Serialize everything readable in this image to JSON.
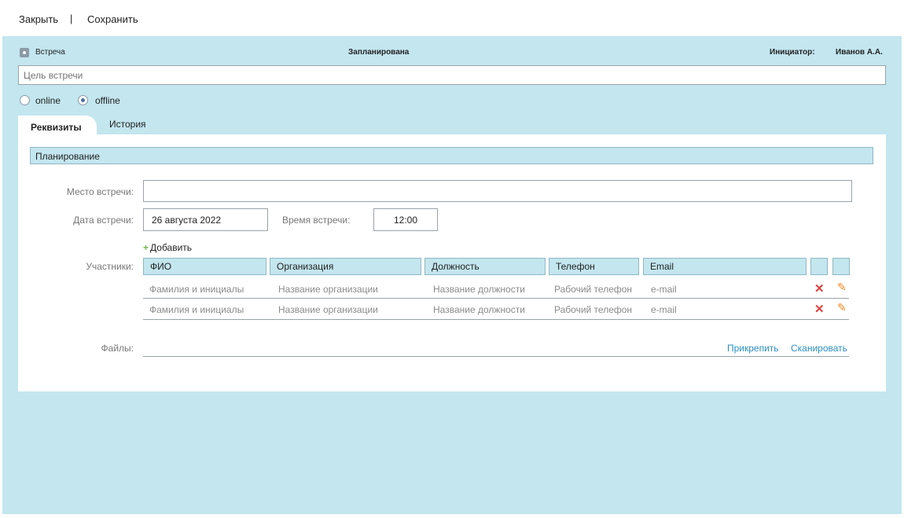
{
  "toolbar": {
    "close_label": "Закрыть",
    "separator": "|",
    "save_label": "Сохранить"
  },
  "header": {
    "type_label": "Встреча",
    "status": "Запланирована",
    "initiator_label": "Инициатор:",
    "initiator_name": "Иванов А.А."
  },
  "purpose": {
    "placeholder": "Цель встречи"
  },
  "mode": {
    "options": [
      "online",
      "offline"
    ],
    "selected": "offline"
  },
  "tabs": [
    {
      "label": "Реквизиты",
      "active": true
    },
    {
      "label": "История",
      "active": false
    }
  ],
  "section": {
    "title": "Планирование"
  },
  "form": {
    "place_label": "Место встречи:",
    "date_label": "Дата встречи:",
    "date_value": "26 августа 2022",
    "time_label": "Время встречи:",
    "time_value": "12:00",
    "add_label": "Добавить",
    "participants_label": "Участники:",
    "files_label": "Файлы:",
    "attach_label": "Прикрепить",
    "scan_label": "Сканировать"
  },
  "table": {
    "columns": [
      "ФИО",
      "Организация",
      "Должность",
      "Телефон",
      "Email"
    ],
    "rows": [
      [
        "Фамилия  и инициалы",
        "Название организации",
        "Название должности",
        "Рабочий телефон",
        "e-mail"
      ],
      [
        "Фамилия  и инициалы",
        "Название организации",
        "Название должности",
        "Рабочий телефон",
        "e-mail"
      ]
    ]
  },
  "icons": {
    "delete": "close-icon",
    "edit": "pencil-icon"
  },
  "colors": {
    "panel_bg": "#c3e6ef",
    "delete": "#e04040",
    "edit": "#f08a24",
    "link": "#2a8fc4",
    "add": "#6bb84a"
  }
}
